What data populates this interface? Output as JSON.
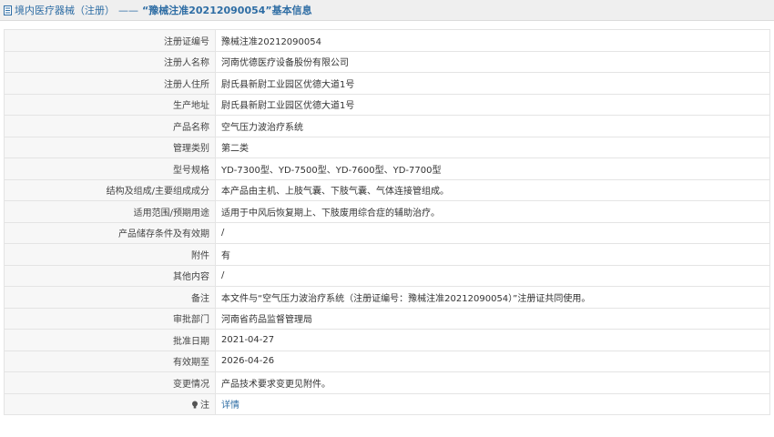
{
  "header": {
    "prefix": "境内医疗器械（注册）",
    "dash": "——",
    "title": "“豫械注准20212090054”基本信息"
  },
  "rows": [
    {
      "label": "注册证编号",
      "value": "豫械注准20212090054"
    },
    {
      "label": "注册人名称",
      "value": "河南优德医疗设备股份有限公司"
    },
    {
      "label": "注册人住所",
      "value": "尉氏县新尉工业园区优德大道1号"
    },
    {
      "label": "生产地址",
      "value": "尉氏县新尉工业园区优德大道1号"
    },
    {
      "label": "产品名称",
      "value": "空气压力波治疗系统"
    },
    {
      "label": "管理类别",
      "value": "第二类"
    },
    {
      "label": "型号规格",
      "value": "YD-7300型、YD-7500型、YD-7600型、YD-7700型"
    },
    {
      "label": "结构及组成/主要组成成分",
      "value": "本产品由主机、上肢气囊、下肢气囊、气体连接管组成。"
    },
    {
      "label": "适用范围/预期用途",
      "value": "适用于中风后恢复期上、下肢废用综合症的辅助治疗。"
    },
    {
      "label": "产品储存条件及有效期",
      "value": "/"
    },
    {
      "label": "附件",
      "value": "有"
    },
    {
      "label": "其他内容",
      "value": "/"
    },
    {
      "label": "备注",
      "value": "本文件与“空气压力波治疗系统（注册证编号：豫械注准20212090054）”注册证共同使用。"
    },
    {
      "label": "审批部门",
      "value": "河南省药品监督管理局"
    },
    {
      "label": "批准日期",
      "value": "2021-04-27"
    },
    {
      "label": "有效期至",
      "value": "2026-04-26"
    },
    {
      "label": "变更情况",
      "value": "产品技术要求变更见附件。"
    }
  ],
  "note_row": {
    "label": "注",
    "link": "详情",
    "icon": "lightbulb-icon"
  }
}
